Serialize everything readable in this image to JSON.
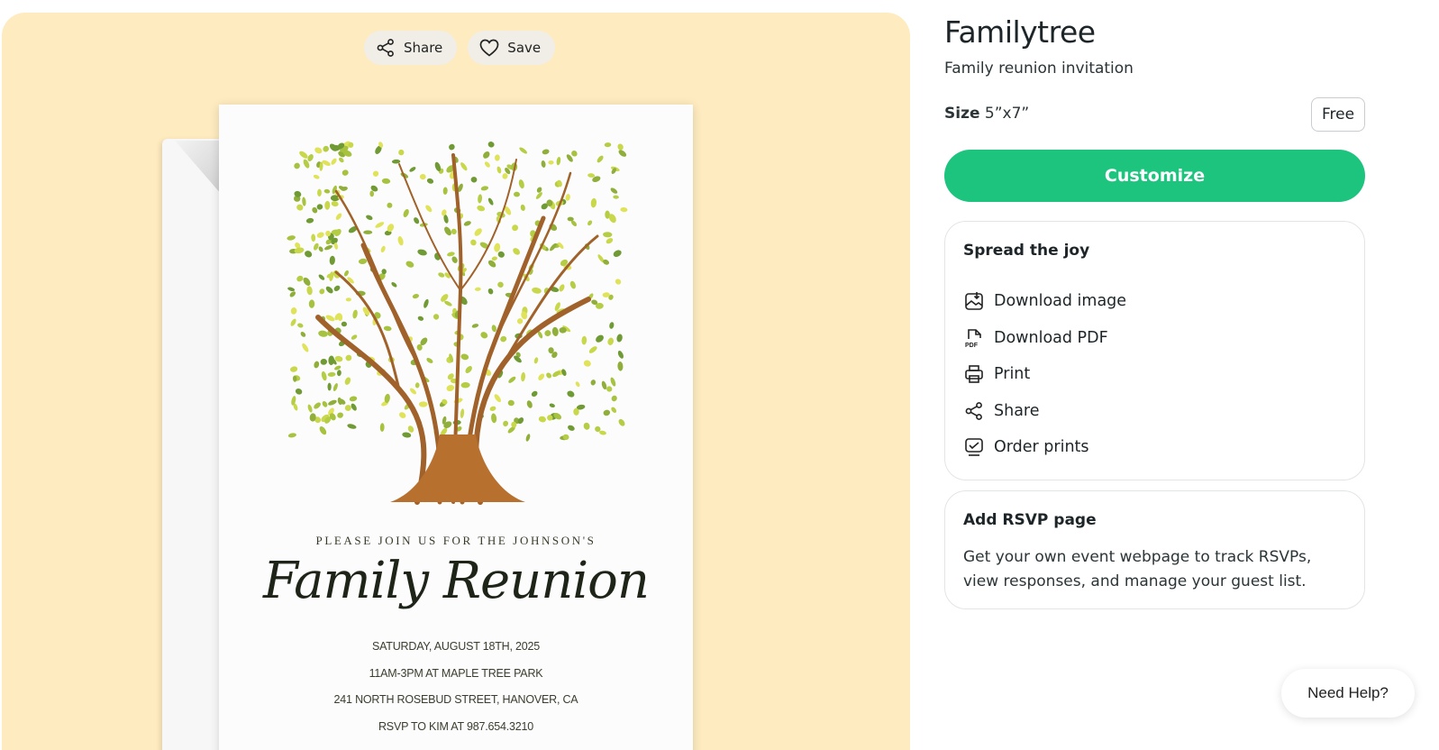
{
  "preview": {
    "share_label": "Share",
    "save_label": "Save",
    "card": {
      "intro": "PLEASE JOIN US FOR THE JOHNSON'S",
      "title": "Family Reunion",
      "lines": [
        "SATURDAY, AUGUST 18TH, 2025",
        "11AM-3PM AT MAPLE TREE PARK",
        "241 NORTH ROSEBUD STREET, HANOVER, CA",
        "RSVP TO KIM AT 987.654.3210"
      ]
    }
  },
  "details": {
    "title": "Familytree",
    "subtitle": "Family reunion invitation",
    "size_label": "Size",
    "size_value": "5”x7”",
    "price": "Free",
    "customize_label": "Customize"
  },
  "spread": {
    "title": "Spread the joy",
    "items": [
      {
        "label": "Download image",
        "icon": "download-image-icon"
      },
      {
        "label": "Download PDF",
        "icon": "pdf-icon"
      },
      {
        "label": "Print",
        "icon": "printer-icon"
      },
      {
        "label": "Share",
        "icon": "share-icon"
      },
      {
        "label": "Order prints",
        "icon": "order-prints-icon"
      }
    ]
  },
  "rsvp": {
    "title": "Add RSVP page",
    "text": "Get your own event webpage to track RSVPs, view responses, and manage your guest list."
  },
  "help": {
    "label": "Need Help?"
  },
  "colors": {
    "accent": "#1cc47e",
    "preview_bg": "#feebbf"
  }
}
